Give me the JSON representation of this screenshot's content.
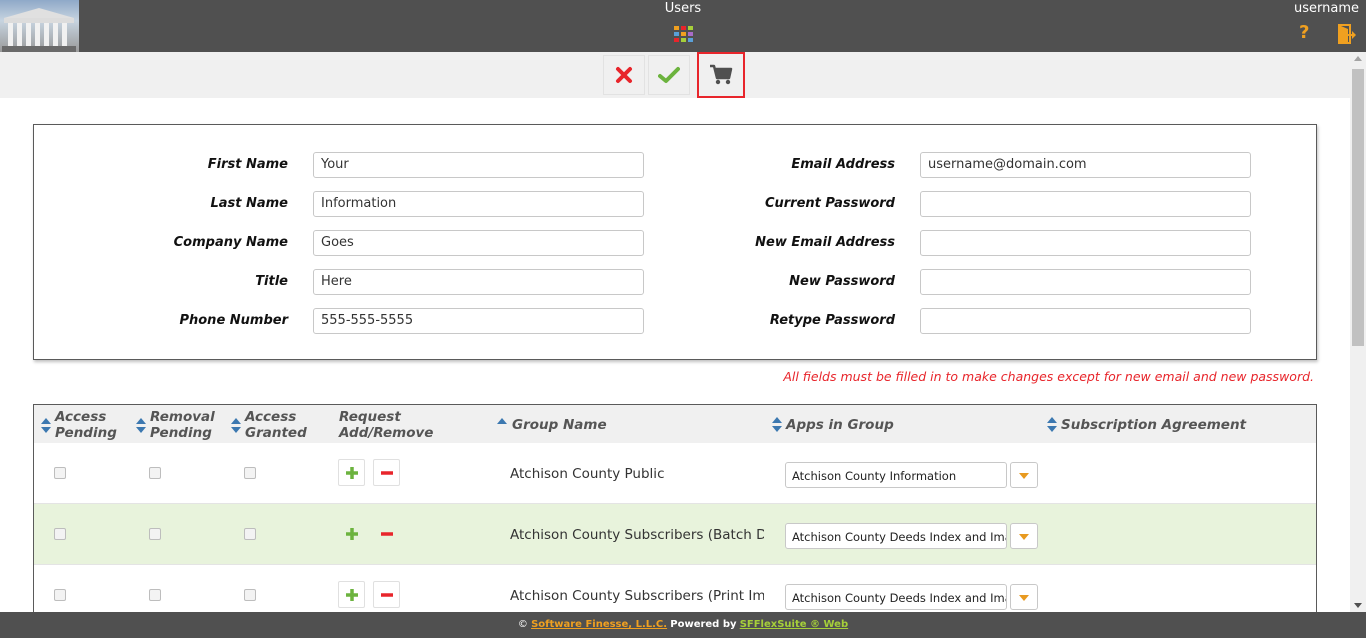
{
  "header": {
    "title": "Users",
    "username": "username",
    "help_glyph": "?"
  },
  "toolbar": {
    "cancel_icon": "close-icon",
    "confirm_icon": "checkmark-icon",
    "cart_icon": "shopping-cart-icon"
  },
  "form": {
    "left": [
      {
        "label": "First Name",
        "value": "Your"
      },
      {
        "label": "Last Name",
        "value": "Information"
      },
      {
        "label": "Company Name",
        "value": "Goes"
      },
      {
        "label": "Title",
        "value": "Here"
      },
      {
        "label": "Phone Number",
        "value": "555-555-5555"
      }
    ],
    "right": [
      {
        "label": "Email Address",
        "value": "username@domain.com"
      },
      {
        "label": "Current Password",
        "value": ""
      },
      {
        "label": "New Email Address",
        "value": ""
      },
      {
        "label": "New Password",
        "value": ""
      },
      {
        "label": "Retype Password",
        "value": ""
      }
    ],
    "note": "All fields must be filled in to make changes except for new email and new password."
  },
  "table": {
    "columns": {
      "access_pending": [
        "Access",
        "Pending"
      ],
      "removal_pending": [
        "Removal",
        "Pending"
      ],
      "access_granted": [
        "Access",
        "Granted"
      ],
      "request": [
        "Request",
        "Add/Remove"
      ],
      "group_name": "Group Name",
      "apps_in_group": "Apps in Group",
      "subscription": "Subscription Agreement"
    },
    "rows": [
      {
        "group": "Atchison County Public",
        "app": "Atchison County Information"
      },
      {
        "group": "Atchison County Subscribers (Batch Do",
        "app": "Atchison County Deeds Index and Ima"
      },
      {
        "group": "Atchison County Subscribers (Print Ima",
        "app": "Atchison County Deeds Index and Ima"
      }
    ]
  },
  "footer": {
    "copyright": "©",
    "company": "Software Finesse, L.L.C.",
    "powered": "Powered by",
    "product": "SFFlexSuite ® Web"
  },
  "colors": {
    "topbar": "#505050",
    "accent_orange": "#f0a020",
    "error_red": "#e8252b",
    "success_green": "#6cb33e",
    "row_highlight": "#e8f3dc"
  }
}
